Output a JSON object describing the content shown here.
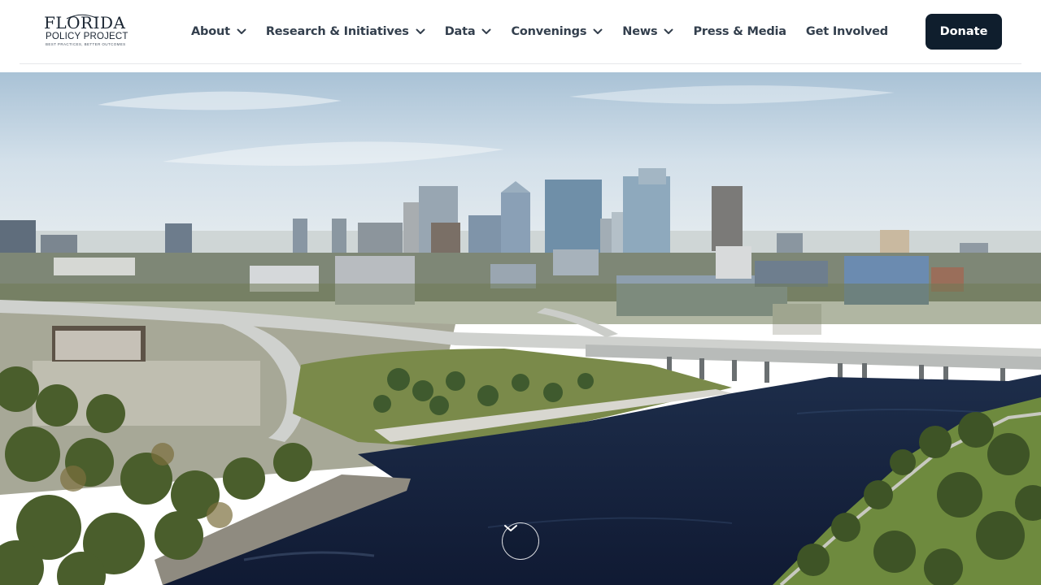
{
  "site": {
    "logo": {
      "line1": "FLORIDA",
      "line2": "POLICY PROJECT",
      "tagline": "BEST PRACTICES, BETTER OUTCOMES"
    }
  },
  "nav": {
    "items": [
      {
        "label": "About",
        "has_dropdown": true,
        "icon": "chevron-down-icon"
      },
      {
        "label": "Research & Initiatives",
        "has_dropdown": true,
        "icon": "chevron-down-icon"
      },
      {
        "label": "Data",
        "has_dropdown": true,
        "icon": "chevron-down-icon"
      },
      {
        "label": "Convenings",
        "has_dropdown": true,
        "icon": "chevron-down-icon"
      },
      {
        "label": "News",
        "has_dropdown": true,
        "icon": "chevron-down-icon"
      },
      {
        "label": "Press & Media",
        "has_dropdown": false
      },
      {
        "label": "Get Involved",
        "has_dropdown": false
      }
    ]
  },
  "header": {
    "donate_label": "Donate"
  },
  "hero": {
    "image_subject": "aerial city skyline with river and highway",
    "scroll_icon": "chevron-down-icon"
  },
  "colors": {
    "nav_text": "#333f4d",
    "donate_bg": "#0f1e2d",
    "donate_text": "#ffffff",
    "logo_text": "#1b2633"
  }
}
